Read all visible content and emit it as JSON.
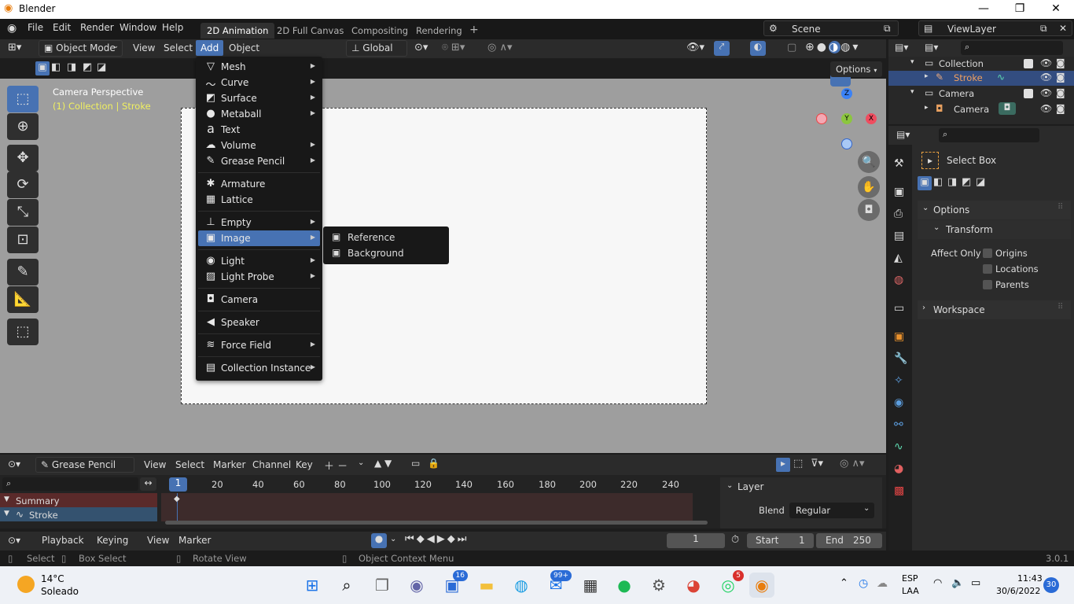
{
  "window": {
    "title": "Blender",
    "minimize": "—",
    "maximize": "❐",
    "close": "✕"
  },
  "menubar": {
    "items": [
      "File",
      "Edit",
      "Render",
      "Window",
      "Help"
    ],
    "workspaces": [
      "2D Animation",
      "2D Full Canvas",
      "Compositing",
      "Rendering"
    ],
    "add_workspace": "+",
    "scene": "Scene",
    "view_layer": "ViewLayer"
  },
  "viewport_header": {
    "mode": "Object Mode",
    "menus": [
      "View",
      "Select",
      "Add",
      "Object"
    ],
    "transform_orientation": "Global",
    "options": "Options"
  },
  "viewport": {
    "camera_label": "Camera Perspective",
    "collection_label": "(1) Collection | Stroke",
    "gizmo": {
      "z": "Z",
      "y": "Y",
      "x": "X"
    }
  },
  "add_menu": {
    "items": [
      {
        "label": "Mesh",
        "icon": "mesh-icon",
        "glyph": "▽",
        "submenu": true
      },
      {
        "label": "Curve",
        "icon": "curve-icon",
        "glyph": "〜",
        "submenu": true
      },
      {
        "label": "Surface",
        "icon": "surface-icon",
        "glyph": "◩",
        "submenu": true
      },
      {
        "label": "Metaball",
        "icon": "metaball-icon",
        "glyph": "●",
        "submenu": true
      },
      {
        "label": "Text",
        "icon": "text-icon",
        "glyph": "a",
        "submenu": false
      },
      {
        "label": "Volume",
        "icon": "volume-icon",
        "glyph": "☁",
        "submenu": true
      },
      {
        "label": "Grease Pencil",
        "icon": "grease-pencil-icon",
        "glyph": "✎",
        "submenu": true
      },
      {
        "label": "Armature",
        "icon": "armature-icon",
        "glyph": "✱",
        "submenu": false
      },
      {
        "label": "Lattice",
        "icon": "lattice-icon",
        "glyph": "▦",
        "submenu": false
      },
      {
        "label": "Empty",
        "icon": "empty-icon",
        "glyph": "⊥",
        "submenu": true
      },
      {
        "label": "Image",
        "icon": "image-icon",
        "glyph": "▣",
        "submenu": true
      },
      {
        "label": "Light",
        "icon": "light-icon",
        "glyph": "◉",
        "submenu": true
      },
      {
        "label": "Light Probe",
        "icon": "light-probe-icon",
        "glyph": "▨",
        "submenu": true
      },
      {
        "label": "Camera",
        "icon": "camera-icon",
        "glyph": "◘",
        "submenu": false
      },
      {
        "label": "Speaker",
        "icon": "speaker-icon",
        "glyph": "◀",
        "submenu": false
      },
      {
        "label": "Force Field",
        "icon": "force-field-icon",
        "glyph": "≋",
        "submenu": true
      },
      {
        "label": "Collection Instance",
        "icon": "collection-instance-icon",
        "glyph": "▤",
        "submenu": true
      }
    ],
    "highlighted": "Image",
    "arrow": "▶"
  },
  "image_submenu": {
    "items": [
      {
        "label": "Reference",
        "glyph": "▣"
      },
      {
        "label": "Background",
        "glyph": "▣"
      }
    ]
  },
  "outliner": {
    "search_placeholder": "",
    "rows": [
      {
        "label": "Collection",
        "kind": "collection"
      },
      {
        "label": "Stroke",
        "kind": "grease-pencil",
        "selected": true
      },
      {
        "label": "Camera",
        "kind": "camera-object"
      },
      {
        "label": "Camera",
        "kind": "camera-data"
      }
    ]
  },
  "properties": {
    "tool_name": "Select Box",
    "options_panel": "Options",
    "transform_panel": "Transform",
    "affect_only": "Affect Only",
    "checkboxes": [
      "Origins",
      "Locations",
      "Parents"
    ],
    "workspace_panel": "Workspace"
  },
  "timeline": {
    "editor": "Grease Pencil",
    "menus": [
      "View",
      "Select",
      "Marker",
      "Channel",
      "Key"
    ],
    "current_frame_marker": "1",
    "ticks": [
      "20",
      "40",
      "60",
      "80",
      "100",
      "120",
      "140",
      "160",
      "180",
      "200",
      "220",
      "240"
    ],
    "channels": [
      {
        "label": "Summary"
      },
      {
        "label": "Stroke"
      }
    ],
    "layer_panel": "Layer",
    "blend_label": "Blend",
    "blend_value": "Regular"
  },
  "playback": {
    "menus": [
      "Playback",
      "Keying",
      "View",
      "Marker"
    ],
    "current_frame": "1",
    "start_label": "Start",
    "start_value": "1",
    "end_label": "End",
    "end_value": "250"
  },
  "status": {
    "select": "Select",
    "box_select": "Box Select",
    "rotate_view": "Rotate View",
    "context_menu": "Object Context Menu",
    "version": "3.0.1"
  },
  "taskbar": {
    "temperature": "14°C",
    "weather": "Soleado",
    "language": "ESP",
    "layout": "LAA",
    "time": "11:43",
    "date": "30/6/2022",
    "notif_count": "30",
    "badges": {
      "teams": "16",
      "mail": "99+",
      "whatsapp": "5"
    }
  }
}
